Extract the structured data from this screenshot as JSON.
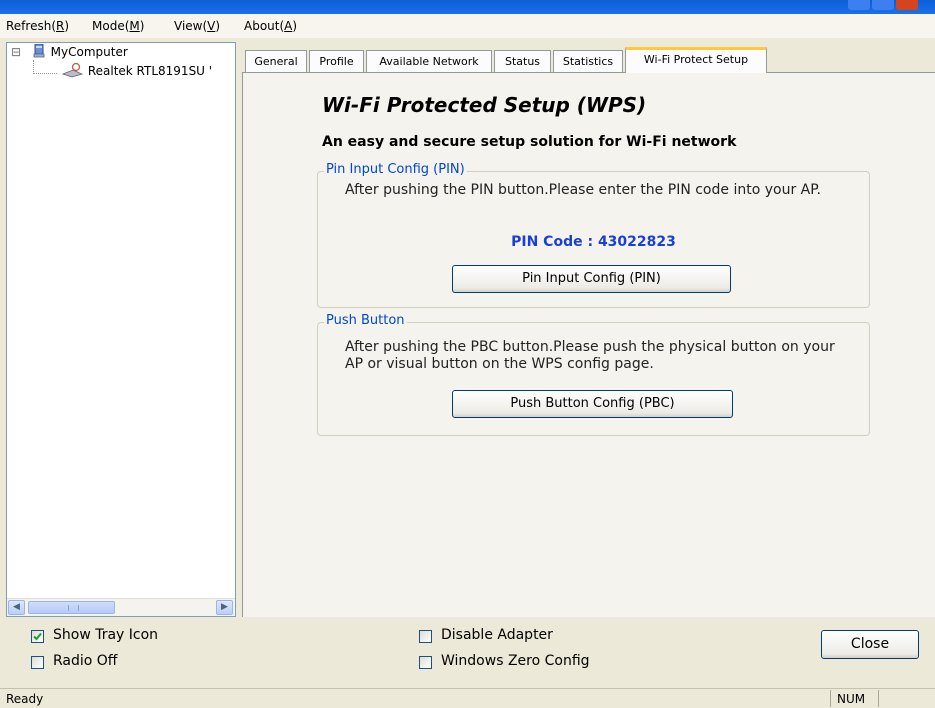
{
  "menu": [
    {
      "label": "Refresh(",
      "key": "R",
      "tail": ")"
    },
    {
      "label": "Mode(",
      "key": "M",
      "tail": ")"
    },
    {
      "label": "View(",
      "key": "V",
      "tail": ")"
    },
    {
      "label": "About(",
      "key": "A",
      "tail": ")"
    }
  ],
  "tree": {
    "root_label": "MyComputer",
    "expander": "⊟",
    "adapter_label": "Realtek RTL8191SU '"
  },
  "tabs": [
    "General",
    "Profile",
    "Available Network",
    "Status",
    "Statistics",
    "Wi-Fi Protect Setup"
  ],
  "wps": {
    "title": "Wi-Fi Protected Setup (WPS)",
    "subtitle": "An easy and secure setup solution for Wi-Fi network",
    "pin_group": {
      "legend": "Pin Input Config (PIN)",
      "description": "After pushing the PIN button.Please enter the PIN code into your AP.",
      "pin_code": "PIN Code :  43022823",
      "button": "Pin Input Config (PIN)"
    },
    "pbc_group": {
      "legend": "Push Button",
      "description": "After pushing the PBC button.Please push the physical button on your AP or visual button on the WPS config page.",
      "button": "Push Button Config (PBC)"
    }
  },
  "options": {
    "show_tray_icon": {
      "label": "Show Tray Icon",
      "checked": true
    },
    "radio_off": {
      "label": "Radio Off",
      "checked": false
    },
    "disable_adapter": {
      "label": "Disable Adapter",
      "checked": false
    },
    "windows_zero_config": {
      "label": "Windows Zero Config",
      "checked": false
    }
  },
  "close_button": "Close",
  "status": {
    "text": "Ready",
    "num": "NUM"
  },
  "colors": {
    "accent": "#0046d5",
    "pin_code": "#1a3fd8",
    "active_tab": "#ffc83c"
  }
}
